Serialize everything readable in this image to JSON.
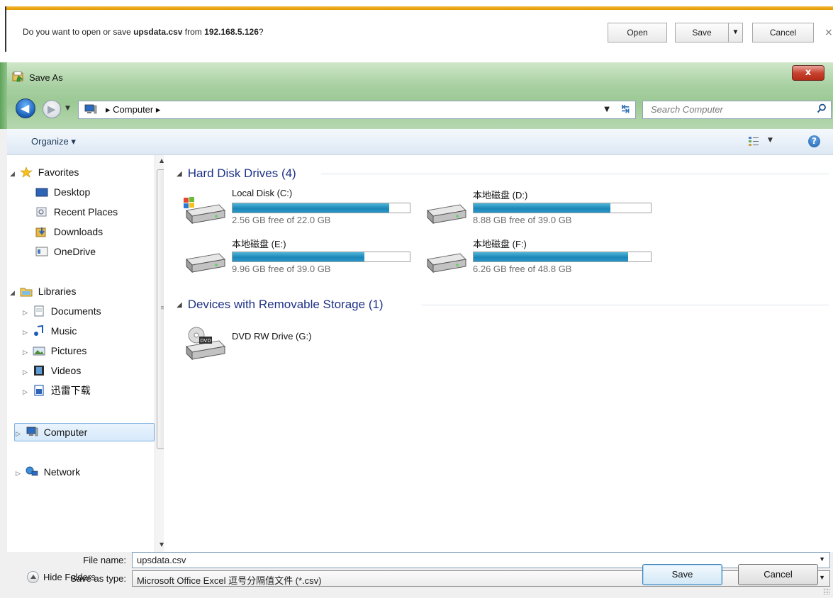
{
  "notification": {
    "prefix": "Do you want to open or save ",
    "filename": "upsdata.csv",
    "middle": " from ",
    "host": "192.168.5.126",
    "suffix": "?",
    "open_label": "Open",
    "save_label": "Save",
    "save_arrow": "▼",
    "cancel_label": "Cancel",
    "close_label": "×"
  },
  "window": {
    "title": "Save As",
    "close_label": "x"
  },
  "address": {
    "crumb_computer": "Computer",
    "separator": "▸"
  },
  "search": {
    "placeholder": "Search Computer"
  },
  "toolbar": {
    "organize": "Organize ▾"
  },
  "nav": {
    "favorites": "Favorites",
    "desktop": "Desktop",
    "recent": "Recent Places",
    "downloads": "Downloads",
    "onedrive": "OneDrive",
    "libraries": "Libraries",
    "documents": "Documents",
    "music": "Music",
    "pictures": "Pictures",
    "videos": "Videos",
    "xunlei": "迅雷下载",
    "computer": "Computer",
    "network": "Network"
  },
  "content": {
    "hard_disks_heading": "Hard Disk Drives (4)",
    "removable_heading": "Devices with Removable Storage (1)",
    "drives": [
      {
        "name": "Local Disk (C:)",
        "free_text": "2.56 GB free of 22.0 GB",
        "used_fraction": 0.884
      },
      {
        "name": "本地磁盘 (D:)",
        "free_text": "8.88 GB free of 39.0 GB",
        "used_fraction": 0.772
      },
      {
        "name": "本地磁盘 (E:)",
        "free_text": "9.96 GB free of 39.0 GB",
        "used_fraction": 0.745
      },
      {
        "name": "本地磁盘 (F:)",
        "free_text": "6.26 GB free of 48.8 GB",
        "used_fraction": 0.872
      }
    ],
    "dvd_name": "DVD RW Drive (G:)",
    "dvd_badge": "DVD"
  },
  "fields": {
    "file_name_label": "File name:",
    "file_name_value": "upsdata.csv",
    "save_type_label": "Save as type:",
    "save_type_value": "Microsoft Office Excel 逗号分隔值文件 (*.csv)",
    "dropdown_arrow": "▼"
  },
  "footer": {
    "hide_folders": "Hide Folders",
    "save": "Save",
    "cancel": "Cancel"
  },
  "colors": {
    "accent": "#f7b733",
    "group_heading": "#1e3287",
    "bar_fill": "#1c86b8"
  }
}
